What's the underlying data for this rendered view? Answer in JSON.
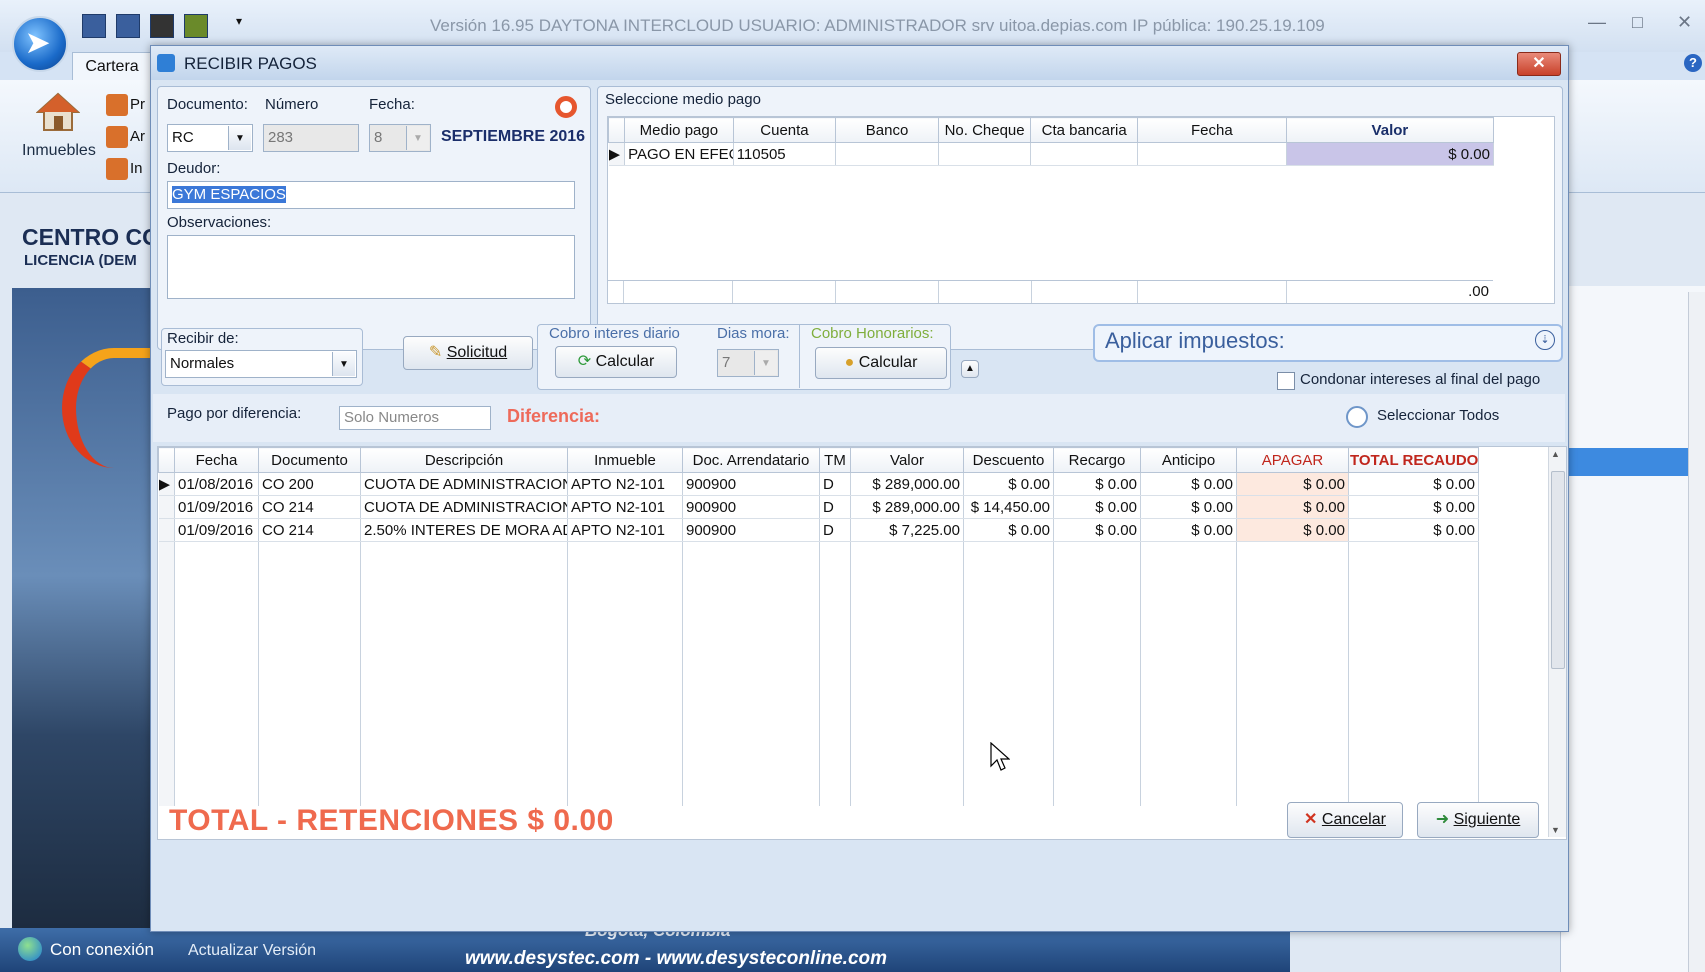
{
  "app": {
    "title": "Versión 16.95 DAYTONA INTERCLOUD  USUARIO: ADMINISTRADOR srv uitoa.depias.com IP pública: 190.25.19.109",
    "tab": "Cartera",
    "ribbon_big": "Inmuebles",
    "ribbon_items": [
      "Pr",
      "Ar",
      "In"
    ],
    "company": "CENTRO CO",
    "license": "LICENCIA (DEM",
    "status": "Con conexión",
    "update": "Actualizar Versión",
    "city": "Bogota, Colombia",
    "website": "www.desystec.com - www.desysteconline.com"
  },
  "dialog": {
    "title": "RECIBIR PAGOS",
    "documento_label": "Documento:",
    "documento_value": "RC",
    "numero_label": "Número",
    "numero_value": "283",
    "fecha_label": "Fecha:",
    "fecha_value": "8",
    "month_year": "SEPTIEMBRE 2016",
    "deudor_label": "Deudor:",
    "deudor_value": "GYM ESPACIOS",
    "observaciones_label": "Observaciones:",
    "medio_pago_title": "Seleccione medio pago",
    "medio_cols": [
      "Medio pago",
      "Cuenta",
      "Banco",
      "No. Cheque",
      "Cta bancaria",
      "Fecha",
      "Valor"
    ],
    "medio_rows": [
      [
        "PAGO EN EFEC",
        "110505",
        "",
        "",
        "",
        "",
        "$ 0.00"
      ]
    ],
    "medio_total": ".00",
    "recibir_label": "Recibir de:",
    "recibir_value": "Normales",
    "solicitud_button": "Solicitud",
    "cobro_interes_label": "Cobro interes diario",
    "calcular_label": "Calcular",
    "dias_mora_label": "Dias mora:",
    "dias_mora_value": "7",
    "cobro_honorarios_label": "Cobro Honorarios:",
    "calcular2_label": "Calcular",
    "impuestos_label": "Aplicar impuestos:",
    "condonar_label": "Condonar intereses al final del pago",
    "pago_diferencia_label": "Pago por diferencia:",
    "pago_diferencia_placeholder": "Solo Numeros",
    "diferencia_label": "Diferencia:",
    "seleccionar_todos_label": "Seleccionar Todos",
    "table_cols": [
      "Fecha",
      "Documento",
      "Descripción",
      "Inmueble",
      "Doc. Arrendatario",
      "TM",
      "Valor",
      "Descuento",
      "Recargo",
      "Anticipo",
      "APAGAR",
      "TOTAL RECAUDO"
    ],
    "table_rows": [
      [
        "01/08/2016",
        "CO 200",
        "CUOTA DE ADMINISTRACION",
        "APTO N2-101",
        "900900",
        "D",
        "$ 289,000.00",
        "$ 0.00",
        "$ 0.00",
        "$ 0.00",
        "$ 0.00",
        "$ 0.00"
      ],
      [
        "01/09/2016",
        "CO 214",
        "CUOTA DE ADMINISTRACION",
        "APTO N2-101",
        "900900",
        "D",
        "$ 289,000.00",
        "$ 14,450.00",
        "$ 0.00",
        "$ 0.00",
        "$ 0.00",
        "$ 0.00"
      ],
      [
        "01/09/2016",
        "CO 214",
        "2.50% INTERES DE MORA AD",
        "APTO N2-101",
        "900900",
        "D",
        "$ 7,225.00",
        "$ 0.00",
        "$ 0.00",
        "$ 0.00",
        "$ 0.00",
        "$ 0.00"
      ]
    ],
    "total_label": "TOTAL - RETENCIONES $ 0.00",
    "cancel_button": "Cancelar",
    "next_button": "Siguiente"
  }
}
